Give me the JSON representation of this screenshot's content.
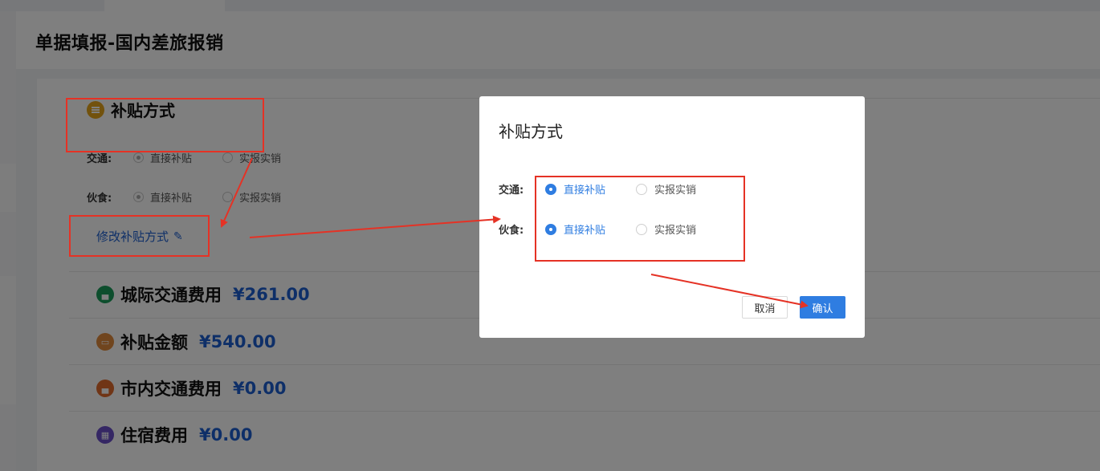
{
  "page": {
    "title": "单据填报-国内差旅报销"
  },
  "subsidy_section": {
    "title": "补贴方式",
    "rows": [
      {
        "label": "交通:",
        "options": [
          "直接补贴",
          "实报实销"
        ],
        "selected": 0
      },
      {
        "label": "伙食:",
        "options": [
          "直接补贴",
          "实报实销"
        ],
        "selected": 0
      }
    ],
    "edit_link": "修改补贴方式"
  },
  "fees": [
    {
      "name": "城际交通费用",
      "amount": "¥261.00",
      "icon": "car-icon",
      "color": "#1a9c5b"
    },
    {
      "name": "补贴金额",
      "amount": "¥540.00",
      "icon": "ticket-icon",
      "color": "#e08a3c"
    },
    {
      "name": "市内交通费用",
      "amount": "¥0.00",
      "icon": "taxi-icon",
      "color": "#e06a2c"
    },
    {
      "name": "住宿费用",
      "amount": "¥0.00",
      "icon": "hotel-icon",
      "color": "#6a4fc8"
    }
  ],
  "modal": {
    "title": "补贴方式",
    "rows": [
      {
        "label": "交通:",
        "options": [
          "直接补贴",
          "实报实销"
        ],
        "selected": 0
      },
      {
        "label": "伙食:",
        "options": [
          "直接补贴",
          "实报实销"
        ],
        "selected": 0
      }
    ],
    "cancel_label": "取消",
    "ok_label": "确认"
  },
  "colors": {
    "accent": "#2f7de1",
    "annotation": "#e53225"
  }
}
